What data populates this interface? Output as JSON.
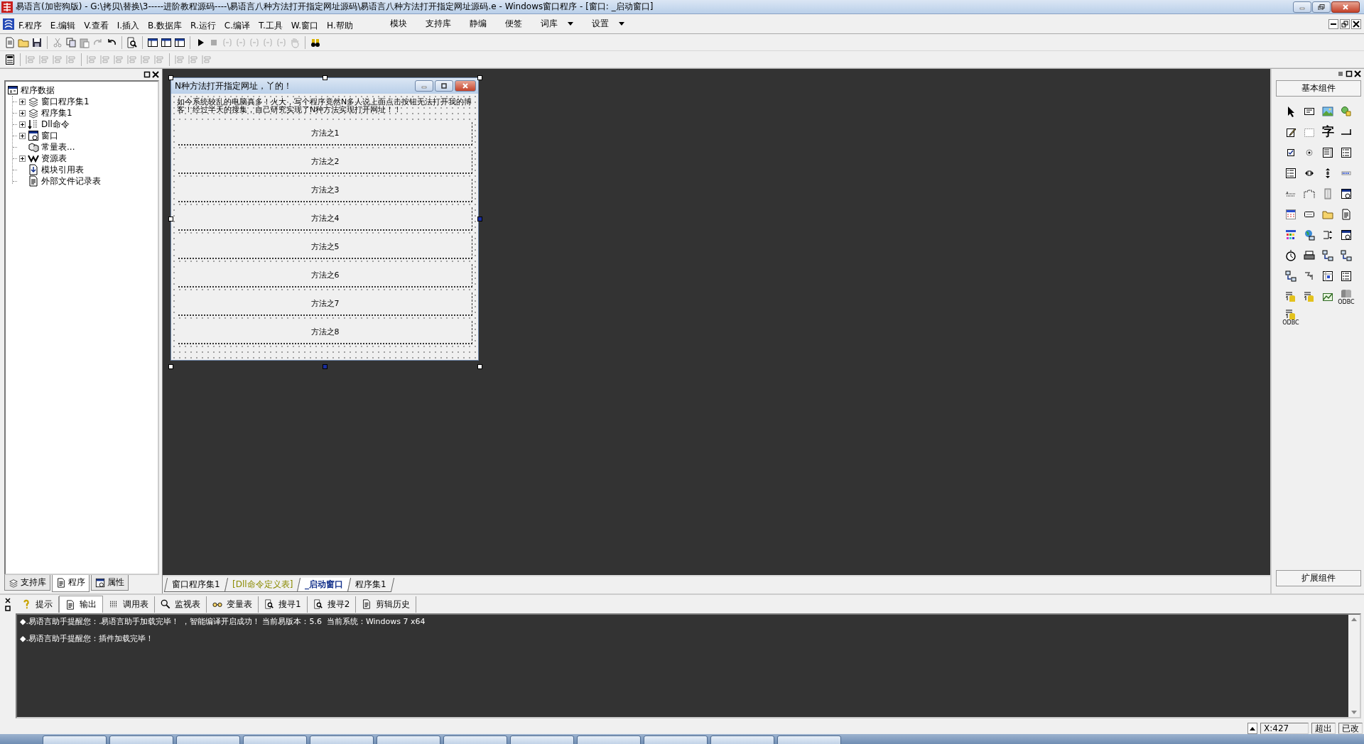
{
  "window": {
    "title": "易语言(加密狗版) - G:\\拷贝\\替换\\3-----进阶教程源码----\\易语言八种方法打开指定网址源码\\易语言八种方法打开指定网址源码.e - Windows窗口程序 - [窗口: _启动窗口]"
  },
  "menu": {
    "items": [
      "F.程序",
      "E.编辑",
      "V.查看",
      "I.插入",
      "B.数据库",
      "R.运行",
      "C.编译",
      "T.工具",
      "W.窗口",
      "H.帮助"
    ],
    "extras": [
      {
        "label": "模块",
        "dropdown": false
      },
      {
        "label": "支持库",
        "dropdown": false
      },
      {
        "label": "静编",
        "dropdown": false
      },
      {
        "label": "便签",
        "dropdown": false
      },
      {
        "label": "词库",
        "dropdown": true
      },
      {
        "label": "设置",
        "dropdown": true
      }
    ]
  },
  "tree": {
    "label": "程序数据",
    "children": [
      {
        "label": "窗口程序集1",
        "kind": "group"
      },
      {
        "label": "程序集1",
        "kind": "group"
      },
      {
        "label": "Dll命令",
        "kind": "group"
      },
      {
        "label": "窗口",
        "kind": "group"
      },
      {
        "label": "常量表...",
        "kind": "leaf"
      },
      {
        "label": "资源表",
        "kind": "group"
      },
      {
        "label": "模块引用表",
        "kind": "leaf"
      },
      {
        "label": "外部文件记录表",
        "kind": "leaf"
      }
    ]
  },
  "left_tabs": [
    {
      "label": "支持库",
      "selected": false
    },
    {
      "label": "程序",
      "selected": true
    },
    {
      "label": "属性",
      "selected": false
    }
  ],
  "designer": {
    "title": "N种方法打开指定网址，丫的！",
    "description": "如今系统较乱的电脑真多！火大，写个程序竟然N多人说上面点击按钮无法打开我的博客！经过半天的搜集，自己研究实现了N种方法实现打开网址！！",
    "buttons": [
      "方法之1",
      "方法之2",
      "方法之3",
      "方法之4",
      "方法之5",
      "方法之6",
      "方法之7",
      "方法之8"
    ]
  },
  "document_tabs": [
    {
      "label": "窗口程序集1",
      "kind": "code",
      "selected": false
    },
    {
      "label": "[Dll命令定义表]",
      "kind": "dll",
      "selected": false
    },
    {
      "label": "_启动窗口",
      "kind": "form",
      "selected": true
    },
    {
      "label": "程序集1",
      "kind": "code",
      "selected": false
    }
  ],
  "palette": {
    "title": "基本组件",
    "glyph": "字",
    "captions": [
      "ODBC",
      "ODBC"
    ],
    "footer": "扩展组件"
  },
  "output": {
    "tabs": [
      {
        "label": "提示",
        "selected": false
      },
      {
        "label": "输出",
        "selected": true
      },
      {
        "label": "调用表",
        "selected": false
      },
      {
        "label": "监视表",
        "selected": false
      },
      {
        "label": "变量表",
        "selected": false
      },
      {
        "label": "搜寻1",
        "selected": false
      },
      {
        "label": "搜寻2",
        "selected": false
      },
      {
        "label": "剪辑历史",
        "selected": false
      }
    ],
    "lines": [
      "◆.易语言助手提醒您：.易语言助手加载完毕！ ，智能编译开启成功！ 当前易版本：5.6  当前系统：Windows 7 x64",
      "◆.易语言助手提醒您：插件加载完毕！"
    ]
  },
  "status_bar": {
    "position": "X:427",
    "cells": [
      "超出",
      "已改"
    ]
  }
}
